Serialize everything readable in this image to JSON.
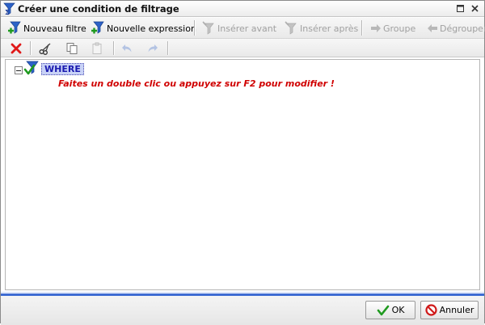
{
  "window": {
    "title": "Créer une condition de filtrage"
  },
  "toolbar": {
    "new_filter": "Nouveau filtre",
    "new_expression": "Nouvelle expression",
    "insert_before": "Insérer avant",
    "insert_after": "Insérer après",
    "group": "Groupe",
    "ungroup": "Dégrouper"
  },
  "tree": {
    "root_label": "WHERE",
    "hint": "Faites un double clic ou appuyez sur F2 pour modifier !"
  },
  "buttons": {
    "ok": "OK",
    "cancel": "Annuler"
  },
  "colors": {
    "accent_blue": "#3d6bd3",
    "hint_red": "#d00000",
    "where_bg": "#c8d2f6",
    "where_text": "#1b1bb0"
  },
  "icons": {
    "title": "filter-sigma-icon",
    "new_filter": "funnel-plus-icon",
    "new_expression": "funnel-plus-icon",
    "insert_before": "funnel-insert-icon",
    "insert_after": "funnel-insert-icon",
    "group": "arrow-right-icon",
    "ungroup": "arrow-left-icon",
    "delete": "red-x-icon",
    "cut": "scissors-icon",
    "copy": "copy-icon",
    "paste": "paste-icon",
    "undo": "undo-icon",
    "redo": "redo-icon",
    "ok": "check-icon",
    "cancel": "no-entry-icon"
  }
}
